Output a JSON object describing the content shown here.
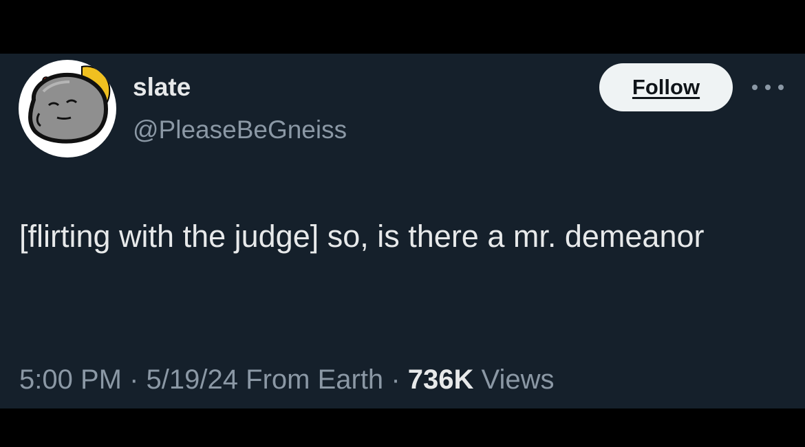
{
  "tweet": {
    "author": {
      "display_name": "slate",
      "handle": "@PleaseBeGneiss",
      "avatar_icon": "rock-character-avatar"
    },
    "follow_label": "Follow",
    "more_icon": "more-horizontal-icon",
    "text": "[flirting with the judge] so, is there a mr. demeanor",
    "time": "5:00 PM",
    "separator": "·",
    "date": "5/19/24",
    "source": "From Earth",
    "views_count": "736K",
    "views_label": "Views"
  },
  "colors": {
    "background": "#15202b",
    "frame": "#000000",
    "primary_text": "#e7e9ea",
    "secondary_text": "#8b98a5",
    "follow_button_bg": "#eff3f4"
  }
}
